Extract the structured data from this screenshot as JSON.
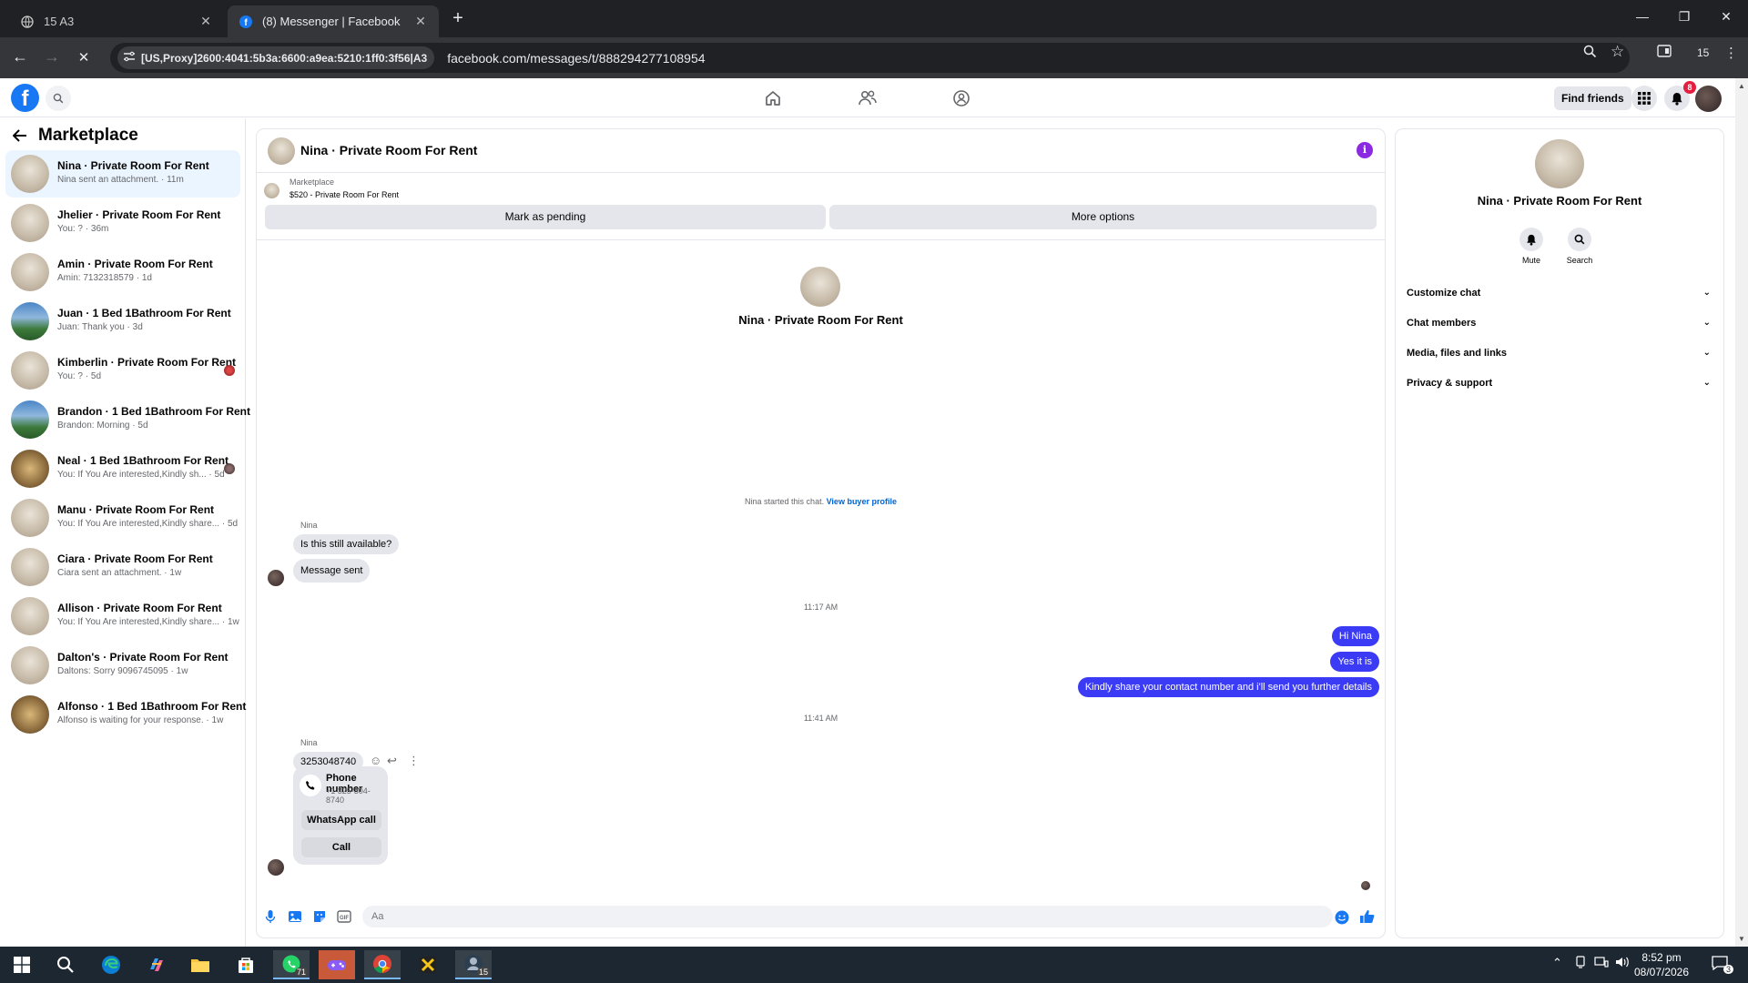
{
  "browser": {
    "tabs": [
      {
        "title": "15 A3"
      },
      {
        "title": "(8) Messenger | Facebook"
      }
    ],
    "site_info": "[US,Proxy]2600:4041:5b3a:6600:a9ea:5210:1ff0:3f56|A3",
    "url": "facebook.com/messages/t/888294277108954",
    "profile_label": "15"
  },
  "header": {
    "find_friends": "Find friends",
    "notification_count": "8"
  },
  "sidebar": {
    "title": "Marketplace",
    "conversations": [
      {
        "name": "Nina · Private Room For Rent",
        "preview": "Nina sent an attachment. · 11m"
      },
      {
        "name": "Jhelier · Private Room For Rent",
        "preview": "You: ? · 36m"
      },
      {
        "name": "Amin · Private Room For Rent",
        "preview": "Amin: 7132318579 · 1d"
      },
      {
        "name": "Juan · 1 Bed 1Bathroom For Rent",
        "preview": "Juan: Thank you · 3d"
      },
      {
        "name": "Kimberlin · Private Room For Rent",
        "preview": "You: ? · 5d"
      },
      {
        "name": "Brandon · 1 Bed 1Bathroom For Rent",
        "preview": "Brandon: Morning · 5d"
      },
      {
        "name": "Neal · 1 Bed 1Bathroom For Rent",
        "preview": "You: If You Are interested,Kindly sh... · 5d"
      },
      {
        "name": "Manu · Private Room For Rent",
        "preview": "You: If You Are interested,Kindly share... · 5d"
      },
      {
        "name": "Ciara · Private Room For Rent",
        "preview": "Ciara sent an attachment. · 1w"
      },
      {
        "name": "Allison · Private Room For Rent",
        "preview": "You: If You Are interested,Kindly share... · 1w"
      },
      {
        "name": "Dalton's · Private Room For Rent",
        "preview": "Daltons: Sorry 9096745095 · 1w"
      },
      {
        "name": "Alfonso · 1 Bed 1Bathroom For Rent",
        "preview": "Alfonso is waiting for your response. · 1w"
      }
    ]
  },
  "chat": {
    "title": "Nina · Private Room For Rent",
    "listing_category": "Marketplace",
    "listing_price_title": "$520 - Private Room For Rent",
    "mark_pending": "Mark as pending",
    "more_options": "More options",
    "intro_name": "Nina · Private Room For Rent",
    "started_text": "Nina started this chat.",
    "view_profile": "View buyer profile",
    "sender_name": "Nina",
    "msg_available": "Is this still available?",
    "msg_sent": "Message sent",
    "time1": "11:17 AM",
    "out1": "Hi Nina",
    "out2": "Yes it is",
    "out3": "Kindly share your contact number and i'll send you further details",
    "time2": "11:41 AM",
    "msg_number": "3253048740",
    "phone_title": "Phone number",
    "phone_value": "+1 325-304-8740",
    "whatsapp_call": "WhatsApp call",
    "call": "Call",
    "composer_placeholder": "Aa"
  },
  "info": {
    "name": "Nina · Private Room For Rent",
    "mute": "Mute",
    "search": "Search",
    "sections": [
      "Customize chat",
      "Chat members",
      "Media, files and links",
      "Privacy & support"
    ]
  },
  "taskbar": {
    "time": "8:52 pm",
    "date": "08/07/2026",
    "whatsapp_badge": "71",
    "app_badge": "15",
    "notif_count": "3"
  },
  "colors": {
    "accent_blue": "#1877f2",
    "outgoing_bubble": "#3b3bf5",
    "info_purple": "#8a2be2"
  }
}
